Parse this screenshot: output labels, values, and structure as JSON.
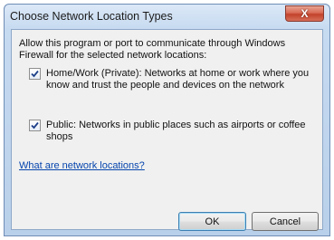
{
  "window": {
    "title": "Choose Network Location Types",
    "close_glyph": "X"
  },
  "content": {
    "description": "Allow this program or port to communicate through Windows Firewall for the selected network locations:",
    "options": [
      {
        "checked": true,
        "label": "Home/Work (Private):  Networks at home or work where you know and trust the people and devices on the network"
      },
      {
        "checked": true,
        "label": "Public:  Networks in public places such as airports or coffee shops"
      }
    ],
    "help_link": "What are network locations?"
  },
  "buttons": {
    "ok": "OK",
    "cancel": "Cancel"
  },
  "colors": {
    "link": "#0645ad",
    "close_button": "#c2432b",
    "default_button_border": "#3c7fb1"
  },
  "icons": [
    "close-icon",
    "checkmark-icon"
  ]
}
